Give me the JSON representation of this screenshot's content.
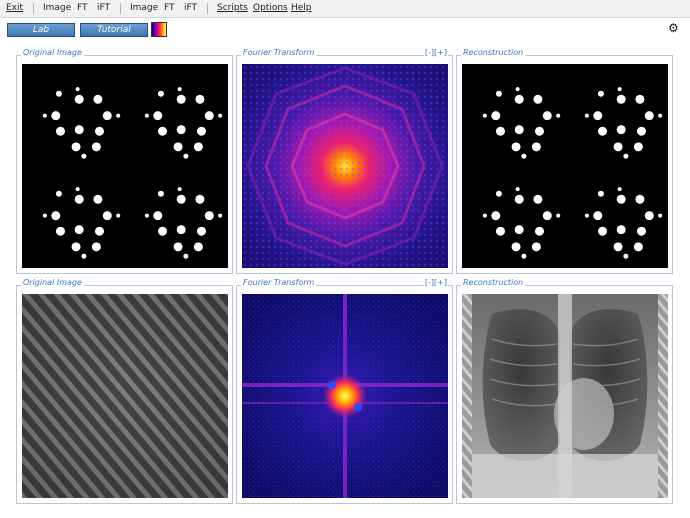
{
  "menu": {
    "exit": "Exit",
    "image1": "Image",
    "ft1": "FT",
    "ift1": "iFT",
    "image2": "Image",
    "ft2": "FT",
    "ift2": "iFT",
    "scripts": "Scripts",
    "options": "Options",
    "help": "Help"
  },
  "toolbar": {
    "lab_label": "Lab",
    "tutorial_label": "Tutorial",
    "colormap_icon": "colormap-swatch",
    "settings_icon": "gear-icon"
  },
  "panels": {
    "row1": {
      "original_title": "Original Image",
      "fourier_title": "Fourier Transform",
      "fourier_controls": "[-][+]",
      "reconstruction_title": "Reconstruction"
    },
    "row2": {
      "original_title": "Original Image",
      "fourier_title": "Fourier Transform",
      "fourier_controls": "[-][+]",
      "reconstruction_title": "Reconstruction"
    }
  },
  "colors": {
    "accent": "#3a76c3",
    "button": "#4a82c0",
    "panel_border": "#b9c6d6"
  }
}
